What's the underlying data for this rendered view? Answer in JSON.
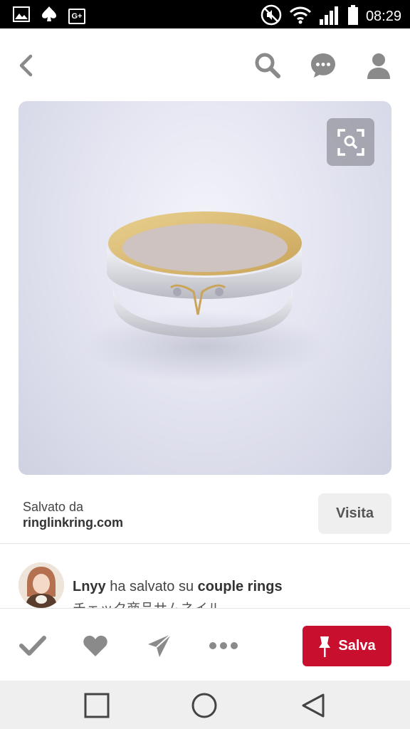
{
  "status_bar": {
    "time": "08:29",
    "left_icons": [
      "gallery-icon",
      "spade-icon",
      "google-plus-icon"
    ],
    "right_icons": [
      "mute-icon",
      "wifi-icon",
      "signal-icon",
      "battery-icon"
    ],
    "gplus_text": "G+"
  },
  "top_bar": {
    "icons": [
      "back-icon",
      "search-icon",
      "messages-icon",
      "profile-icon"
    ]
  },
  "pin": {
    "image_description_icon": "ring-photo",
    "lens_icon": "visual-search-icon"
  },
  "source": {
    "saved_label": "Salvato da",
    "domain": "ringlinkring.com",
    "visit_label": "Visita"
  },
  "activity": {
    "user": "Lnyy",
    "action": "ha salvato su",
    "board": "couple rings",
    "subtitle": "チェック商品サムネイル"
  },
  "action_bar": {
    "icons": [
      "check-icon",
      "heart-icon",
      "send-icon",
      "more-icon"
    ],
    "save_label": "Salva",
    "save_color": "#c8102e"
  },
  "nav": {
    "icons": [
      "recent-apps-icon",
      "home-icon",
      "back-triangle-icon"
    ]
  }
}
